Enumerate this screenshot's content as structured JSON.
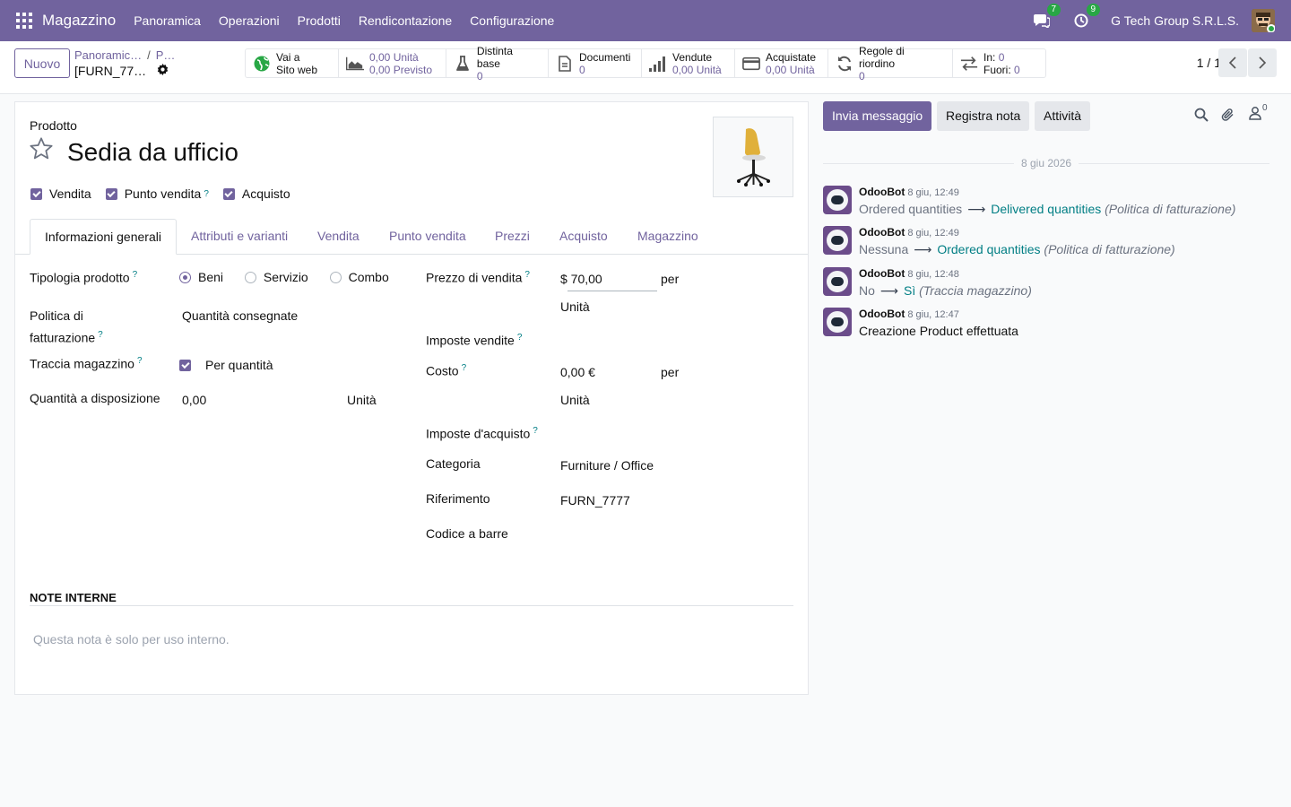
{
  "navbar": {
    "app_name": "Magazzino",
    "menu": [
      "Panoramica",
      "Operazioni",
      "Prodotti",
      "Rendicontazione",
      "Configurazione"
    ],
    "messages_badge": "7",
    "activities_badge": "9",
    "company": "G Tech Group S.R.L.S."
  },
  "control_panel": {
    "new_label": "Nuovo",
    "breadcrumb_parent": "Panoramic…",
    "breadcrumb_sep": "/",
    "breadcrumb_parent2": "P…",
    "breadcrumb_current": "[FURN_77…",
    "pager": "1 / 1",
    "smart_buttons": {
      "website": {
        "line1": "Vai a",
        "line2": "Sito web"
      },
      "forecast": {
        "line1": "0,00 Unità",
        "line2": "0,00 Previsto"
      },
      "bom": {
        "label": "Distinta base",
        "value": "0"
      },
      "documents": {
        "label": "Documenti",
        "value": "0"
      },
      "sold": {
        "label": "Vendute",
        "value": "0,00 Unità"
      },
      "purchased": {
        "label": "Acquistate",
        "value": "0,00 Unità"
      },
      "reorder": {
        "label": "Regole di riordino",
        "value": "0"
      },
      "inout": {
        "in_label": "In:",
        "in_value": "0",
        "out_label": "Fuori:",
        "out_value": "0"
      }
    }
  },
  "form": {
    "product_label": "Prodotto",
    "name": "Sedia da ufficio",
    "checks": {
      "sale": "Vendita",
      "pos": "Punto vendita",
      "purchase": "Acquisto"
    },
    "help_mark": "?",
    "tabs": [
      "Informazioni generali",
      "Attributi e varianti",
      "Vendita",
      "Punto vendita",
      "Prezzi",
      "Acquisto",
      "Magazzino"
    ],
    "left": {
      "type_label": "Tipologia prodotto",
      "type_options": [
        "Beni",
        "Servizio",
        "Combo"
      ],
      "type_selected": "Beni",
      "invoice_policy_label_1": "Politica di",
      "invoice_policy_label_2": "fatturazione",
      "invoice_policy_value": "Quantità consegnate",
      "track_label": "Traccia magazzino",
      "track_value": "Per quantità",
      "qty_label": "Quantità a disposizione",
      "qty_value": "0,00",
      "qty_uom": "Unità"
    },
    "right": {
      "price_label": "Prezzo di vendita",
      "price_value": "$ 70,00",
      "price_per": "per",
      "price_uom": "Unità",
      "sale_taxes_label": "Imposte vendite",
      "cost_label": "Costo",
      "cost_value": "0,00 €",
      "cost_per": "per",
      "cost_uom": "Unità",
      "purchase_taxes_label": "Imposte d'acquisto",
      "category_label": "Categoria",
      "category_value": "Furniture / Office",
      "ref_label": "Riferimento",
      "ref_value": "FURN_7777",
      "barcode_label": "Codice a barre"
    },
    "notes_title": "NOTE INTERNE",
    "notes_placeholder": "Questa nota è solo per uso interno."
  },
  "chatter": {
    "send_message": "Invia messaggio",
    "log_note": "Registra nota",
    "activities": "Attività",
    "followers_count": "0",
    "date_separator": "8 giu 2026",
    "messages": [
      {
        "author": "OdooBot",
        "date": "8 giu, 12:49",
        "old": "Ordered quantities",
        "new": "Delivered quantities",
        "field": "(Politica di fatturazione)"
      },
      {
        "author": "OdooBot",
        "date": "8 giu, 12:49",
        "old": "Nessuna",
        "new": "Ordered quantities",
        "field": "(Politica di fatturazione)"
      },
      {
        "author": "OdooBot",
        "date": "8 giu, 12:48",
        "old": "No",
        "new": "Sì",
        "field": "(Traccia magazzino)"
      },
      {
        "author": "OdooBot",
        "date": "8 giu, 12:47",
        "text": "Creazione Product effettuata"
      }
    ]
  },
  "colors": {
    "brand": "#71639e",
    "link": "#017e84",
    "badge": "#28a745"
  }
}
